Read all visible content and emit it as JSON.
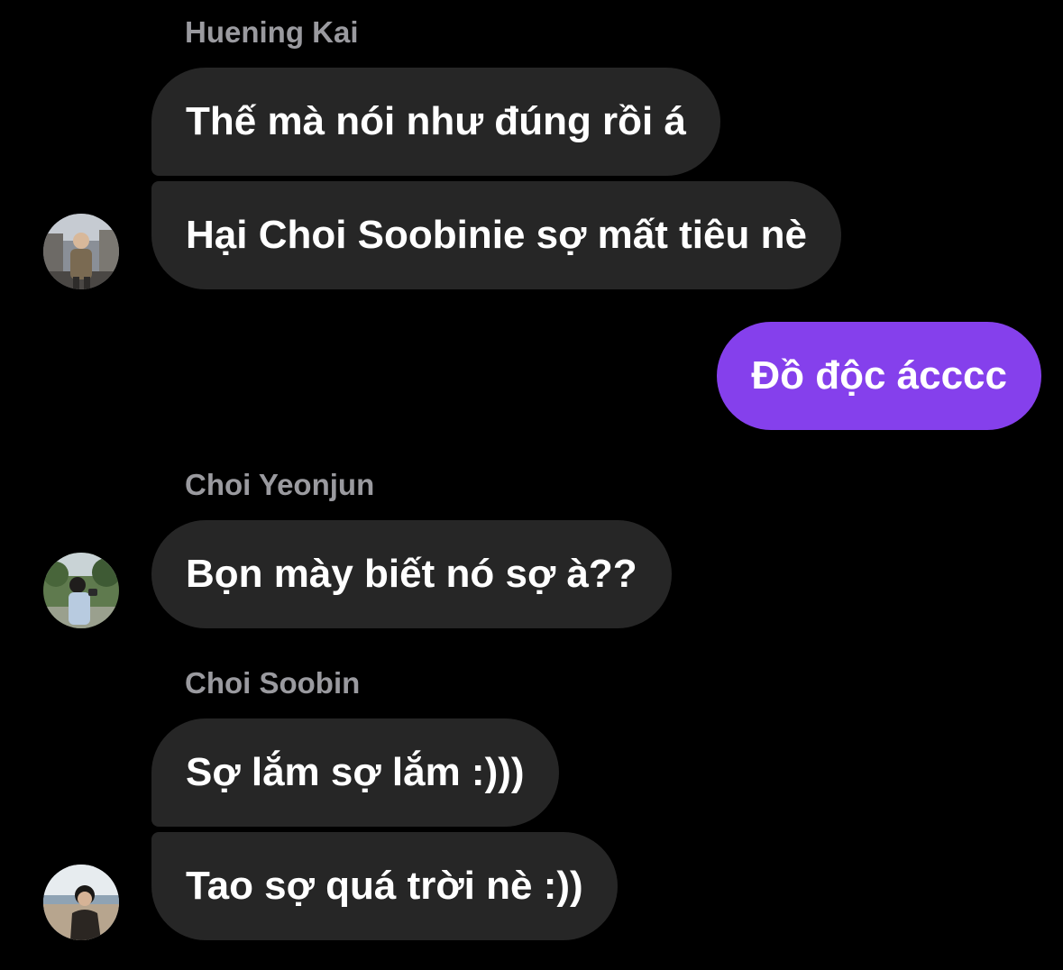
{
  "colors": {
    "background": "#000000",
    "incoming_bubble": "#262626",
    "outgoing_bubble": "#8540ec",
    "sender_name": "#9a9a9f",
    "text": "#ffffff"
  },
  "messages": {
    "group1": {
      "sender": "Huening Kai",
      "avatar_icon": "profile-photo",
      "texts": [
        "Thế mà nói như đúng rồi á",
        "Hại Choi Soobinie sợ mất tiêu nè"
      ]
    },
    "outgoing": {
      "texts": [
        "Đồ độc ácccc"
      ]
    },
    "group2": {
      "sender": "Choi Yeonjun",
      "avatar_icon": "profile-photo",
      "texts": [
        "Bọn mày biết nó sợ à??"
      ]
    },
    "group3": {
      "sender": "Choi Soobin",
      "avatar_icon": "profile-photo",
      "texts": [
        "Sợ lắm sợ lắm :)))",
        "Tao sợ quá trời nè :))"
      ]
    }
  }
}
